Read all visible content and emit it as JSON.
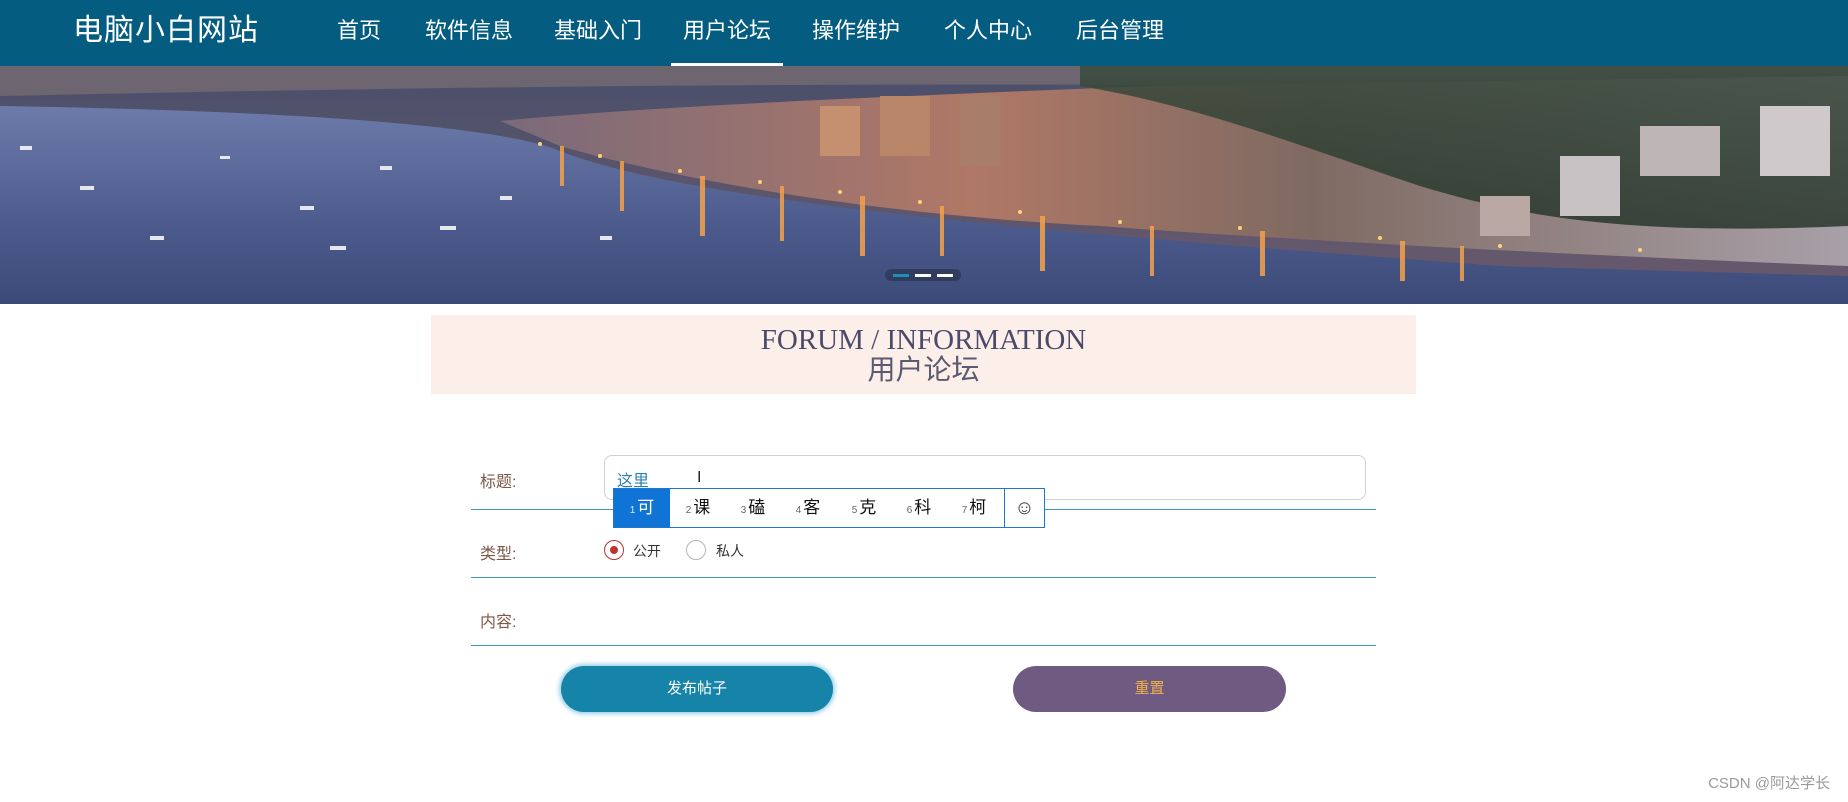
{
  "header": {
    "brand": "电脑小白网站",
    "nav": [
      {
        "label": "首页"
      },
      {
        "label": "软件信息"
      },
      {
        "label": "基础入门"
      },
      {
        "label": "用户论坛",
        "active": true
      },
      {
        "label": "操作维护"
      },
      {
        "label": "个人中心"
      },
      {
        "label": "后台管理"
      }
    ]
  },
  "banner": {
    "image": "harbor-town-at-dusk-photo",
    "slides": 3,
    "active_slide": 1
  },
  "section": {
    "title_en": "FORUM / INFORMATION",
    "title_cn": "用户论坛"
  },
  "form": {
    "title_label": "标题:",
    "title_value": "这里",
    "type_label": "类型:",
    "type_options": [
      {
        "label": "公开",
        "checked": true
      },
      {
        "label": "私人",
        "checked": false
      }
    ],
    "content_label": "内容:",
    "submit_label": "发布帖子",
    "reset_label": "重置"
  },
  "ime": {
    "candidates": [
      {
        "num": "1",
        "text": "可"
      },
      {
        "num": "2",
        "text": "课"
      },
      {
        "num": "3",
        "text": "磕"
      },
      {
        "num": "4",
        "text": "客"
      },
      {
        "num": "5",
        "text": "克"
      },
      {
        "num": "6",
        "text": "科"
      },
      {
        "num": "7",
        "text": "柯"
      }
    ],
    "emoji_icon": "☺"
  },
  "watermark": "CSDN @阿达学长",
  "colors": {
    "nav_bg": "#045c80",
    "title_bg": "#fcefe9",
    "submit_bg": "#1683a8",
    "reset_bg": "#6f5b82",
    "reset_text": "#f0b347",
    "radio_checked": "#c0312f",
    "line": "#3b97b0"
  }
}
